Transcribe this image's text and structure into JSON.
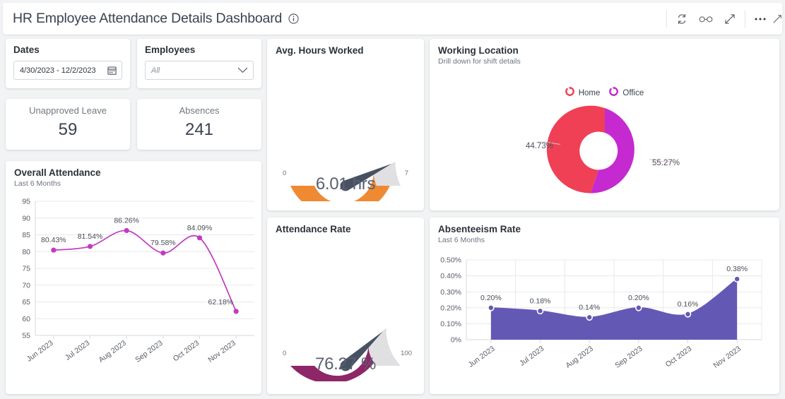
{
  "header": {
    "title": "HR Employee Attendance Details Dashboard",
    "info_icon": "info-circle-icon",
    "tools": [
      {
        "name": "refresh-icon",
        "label": "Refresh"
      },
      {
        "name": "glasses-icon",
        "label": "View"
      },
      {
        "name": "expand-icon",
        "label": "Full screen"
      },
      {
        "name": "more-options-icon",
        "label": "More options"
      }
    ]
  },
  "filters": {
    "dates": {
      "label": "Dates",
      "value": "4/30/2023 - 12/2/2023",
      "icon": "calendar-icon"
    },
    "employees": {
      "label": "Employees",
      "value": "All",
      "placeholder": "All",
      "icon": "chevron-down-icon"
    }
  },
  "kpis": [
    {
      "label": "Unapproved Leave",
      "value": "59"
    },
    {
      "label": "Absences",
      "value": "241"
    }
  ],
  "colors": {
    "orange": "#ef8a33",
    "purple_gauge": "#8e2667",
    "magenta_line": "#c13bc1",
    "home_red": "#ef4056",
    "office_purple": "#c42ad0",
    "area_blue": "#6359b5",
    "gauge_track": "#e0e0e2"
  },
  "chart_data": [
    {
      "id": "overall-attendance",
      "type": "line",
      "title": "Overall Attendance",
      "subtitle": "Last 6 Months",
      "categories": [
        "Jun 2023",
        "Jul 2023",
        "Aug 2023",
        "Sep 2023",
        "Oct 2023",
        "Nov 2023"
      ],
      "values": [
        80.43,
        81.54,
        86.26,
        79.58,
        84.09,
        62.18
      ],
      "data_labels": [
        "80.43%",
        "81.54%",
        "86.26%",
        "79.58%",
        "84.09%",
        "62.18%"
      ],
      "yticks": [
        95,
        90,
        85,
        80,
        75,
        70,
        65,
        60,
        55
      ],
      "ylim": [
        55,
        95
      ],
      "xlabel": "",
      "ylabel": "",
      "grid": true,
      "legend": "none",
      "series_color": "#c13bc1"
    },
    {
      "id": "avg-hours-worked",
      "type": "gauge",
      "title": "Avg. Hours Worked",
      "subtitle": "",
      "value": 6.01,
      "value_label": "6.01 hrs",
      "min": 0,
      "max": 7,
      "min_label": "0",
      "max_label": "7",
      "arc_color": "#ef8a33",
      "track_color": "#e0e0e2"
    },
    {
      "id": "working-location",
      "type": "pie",
      "title": "Working Location",
      "subtitle": "Drill down for shift details",
      "labels": [
        "Home",
        "Office"
      ],
      "values": [
        55.27,
        44.73
      ],
      "data_labels": [
        "55.27%",
        "44.73%"
      ],
      "colors": [
        "#ef4056",
        "#c42ad0"
      ],
      "legend": "top",
      "donut": true
    },
    {
      "id": "attendance-rate",
      "type": "gauge",
      "title": "Attendance Rate",
      "subtitle": "",
      "value": 76.27,
      "value_label": "76.27 %",
      "min": 0,
      "max": 100,
      "min_label": "0",
      "max_label": "100",
      "arc_color": "#8e2667",
      "track_color": "#e0e0e2"
    },
    {
      "id": "absenteeism-rate",
      "type": "area",
      "title": "Absenteeism Rate",
      "subtitle": "Last 6 Months",
      "categories": [
        "Jun 2023",
        "Jul 2023",
        "Aug 2023",
        "Sep 2023",
        "Oct 2023",
        "Nov 2023"
      ],
      "values": [
        0.2,
        0.18,
        0.14,
        0.2,
        0.16,
        0.38
      ],
      "data_labels": [
        "0.20%",
        "0.18%",
        "0.14%",
        "0.20%",
        "0.16%",
        "0.38%"
      ],
      "ytick_labels": [
        "0.50%",
        "0.40%",
        "0.30%",
        "0.20%",
        "0.10%",
        "0%"
      ],
      "ylim": [
        0,
        0.5
      ],
      "grid": true,
      "legend": "none",
      "series_color": "#6359b5"
    }
  ]
}
